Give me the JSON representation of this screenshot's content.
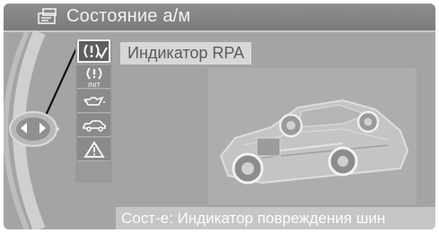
{
  "header": {
    "title": "Состояние а/м",
    "icon": "car-service-icon"
  },
  "menu": {
    "items": [
      {
        "icon": "tire-pressure-warning-icon",
        "text": "(!)",
        "selected": true
      },
      {
        "icon": "tire-pressure-init-icon",
        "text": "INIT",
        "selected": false
      },
      {
        "icon": "oil-can-icon",
        "selected": false
      },
      {
        "icon": "car-icon",
        "selected": false
      },
      {
        "icon": "warning-triangle-icon",
        "selected": false
      }
    ],
    "selected_label": "Индикатор RPA"
  },
  "status": {
    "text": "Сост-е: Индикатор повреждения шин"
  },
  "colors": {
    "background": "#a4a4a4",
    "title_bar": "#858585",
    "selected_item": "#5e5e5e",
    "label_background": "#d7d7d7",
    "status_bar": "#c6c6c6"
  }
}
